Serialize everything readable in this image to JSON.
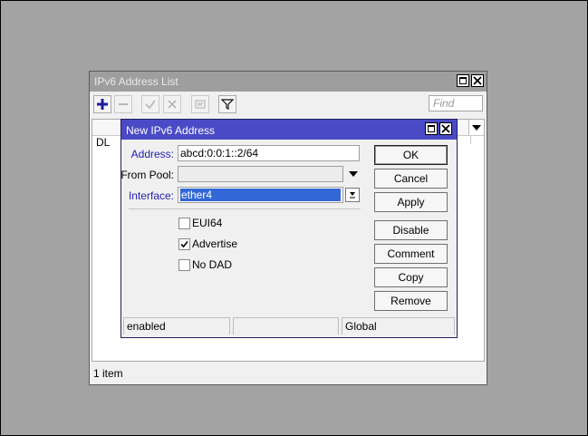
{
  "list_window": {
    "title": "IPv6 Address List",
    "find_placeholder": "Find",
    "row_flag": "DL",
    "status": "1 item",
    "toolbar": [
      "add-icon",
      "remove-icon",
      "enable-icon",
      "disable-icon",
      "comment-icon",
      "filter-icon"
    ]
  },
  "dialog": {
    "title": "New IPv6 Address",
    "address_label": "Address:",
    "address_value": "abcd:0:0:1::2/64",
    "from_pool_label": "From Pool:",
    "from_pool_value": "",
    "interface_label": "Interface:",
    "interface_value": "ether4",
    "checkboxes": [
      {
        "label": "EUI64",
        "checked": false
      },
      {
        "label": "Advertise",
        "checked": true
      },
      {
        "label": "No DAD",
        "checked": false
      }
    ],
    "buttons": [
      "OK",
      "Cancel",
      "Apply",
      "Disable",
      "Comment",
      "Copy",
      "Remove"
    ],
    "status": [
      "enabled",
      "",
      "Global"
    ]
  },
  "colors": {
    "dialog_title_bg": "#4a4ac7",
    "label_blue": "#1f1fb0",
    "selection": "#3167d6"
  }
}
